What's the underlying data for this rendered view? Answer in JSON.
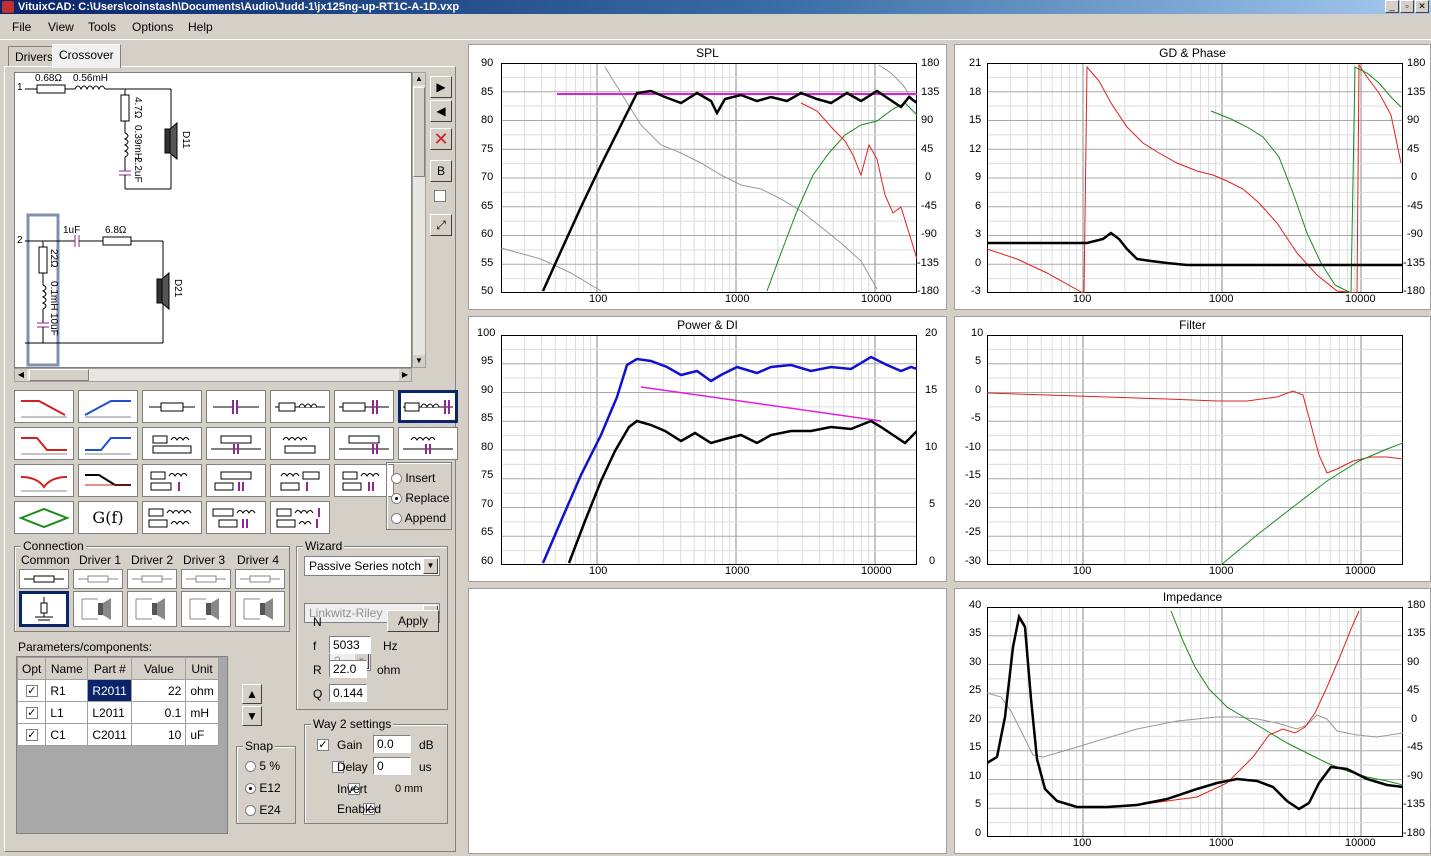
{
  "window": {
    "title": "VituixCAD: C:\\Users\\coinstash\\Documents\\Audio\\Judd-1\\jx125ng-up-RT1C-A-1D.vxp"
  },
  "menu": [
    "File",
    "View",
    "Tools",
    "Options",
    "Help"
  ],
  "tabs": [
    {
      "label": "Drivers"
    },
    {
      "label": "Crossover"
    }
  ],
  "schematic": {
    "branch1": {
      "number": "1",
      "r_series": "0.68Ω",
      "l_series": "0.56mH",
      "r_shunt": "4.7Ω",
      "l_shunt": "0.39mH",
      "c_shunt": "2.2uF",
      "driver": "D11"
    },
    "branch2": {
      "number": "2",
      "c_series": "1uF",
      "r_series": "6.8Ω",
      "r_notch": "22Ω",
      "l_notch": "0.1mH",
      "c_notch": "10uF",
      "driver": "D21"
    }
  },
  "side_buttons": {
    "b_label": "B"
  },
  "palette_insert_mode": {
    "options": [
      "Insert",
      "Replace",
      "Append"
    ],
    "selected": "Replace"
  },
  "connection": {
    "title": "Connection",
    "columns": [
      "Common",
      "Driver 1",
      "Driver 2",
      "Driver 3",
      "Driver 4"
    ]
  },
  "wizard": {
    "title": "Wizard",
    "type": "Passive Series notch",
    "alignment": "Linkwitz-Riley",
    "n_label": "N",
    "n_value": "2",
    "apply_label": "Apply",
    "f_label": "f",
    "f_value": "5033",
    "f_unit": "Hz",
    "r_label": "R",
    "r_value": "22.0",
    "r_unit": "ohm",
    "q_label": "Q",
    "q_value": "0.144"
  },
  "params": {
    "title": "Parameters/components:",
    "headers": [
      "Opt",
      "Name",
      "Part #",
      "Value",
      "Unit"
    ],
    "rows": [
      {
        "name": "R1",
        "part": "R2011",
        "value": "22",
        "unit": "ohm"
      },
      {
        "name": "L1",
        "part": "L2011",
        "value": "0.1",
        "unit": "mH"
      },
      {
        "name": "C1",
        "part": "C2011",
        "value": "10",
        "unit": "uF"
      }
    ]
  },
  "snap": {
    "title": "Snap",
    "options": [
      "5 %",
      "E12",
      "E24"
    ],
    "selected": "E12"
  },
  "way2": {
    "title": "Way 2 settings",
    "gain_label": "Gain",
    "gain_value": "0.0",
    "gain_unit": "dB",
    "delay_label": "Delay",
    "delay_value": "0",
    "delay_unit": "us",
    "invert_label": "Invert",
    "invert_mm": "0 mm",
    "enabled_label": "Enabled"
  },
  "colors": {
    "black": "#000000",
    "red": "#e02020",
    "green": "#1a8a1a",
    "gray": "#999999",
    "magenta": "#e020e0",
    "blue": "#1010d0"
  },
  "charts": {
    "spl": {
      "title": "SPL",
      "yleft": [
        "90",
        "85",
        "80",
        "75",
        "70",
        "65",
        "60",
        "55",
        "50"
      ],
      "yright": [
        "180",
        "135",
        "90",
        "45",
        "0",
        "-45",
        "-90",
        "-135",
        "-180"
      ],
      "xticks": [
        "100",
        "1000",
        "10000"
      ]
    },
    "gd": {
      "title": "GD & Phase",
      "yleft": [
        "21",
        "18",
        "15",
        "12",
        "9",
        "6",
        "3",
        "0",
        "-3"
      ],
      "yright": [
        "180",
        "135",
        "90",
        "45",
        "0",
        "-45",
        "-90",
        "-135",
        "-180"
      ],
      "xticks": [
        "100",
        "1000",
        "10000"
      ]
    },
    "power": {
      "title": "Power & DI",
      "yleft": [
        "100",
        "95",
        "90",
        "85",
        "80",
        "75",
        "70",
        "65",
        "60"
      ],
      "yright": [
        "20",
        "15",
        "10",
        "5",
        "0"
      ],
      "xticks": [
        "100",
        "1000",
        "10000"
      ]
    },
    "filter": {
      "title": "Filter",
      "yleft": [
        "10",
        "5",
        "0",
        "-5",
        "-10",
        "-15",
        "-20",
        "-25",
        "-30"
      ],
      "xticks": [
        "100",
        "1000",
        "10000"
      ]
    },
    "impedance": {
      "title": "Impedance",
      "yleft": [
        "40",
        "35",
        "30",
        "25",
        "20",
        "15",
        "10",
        "5",
        "0"
      ],
      "yright": [
        "180",
        "135",
        "90",
        "45",
        "0",
        "-45",
        "-90",
        "-135",
        "-180"
      ],
      "xticks": [
        "100",
        "1000",
        "10000"
      ]
    }
  }
}
